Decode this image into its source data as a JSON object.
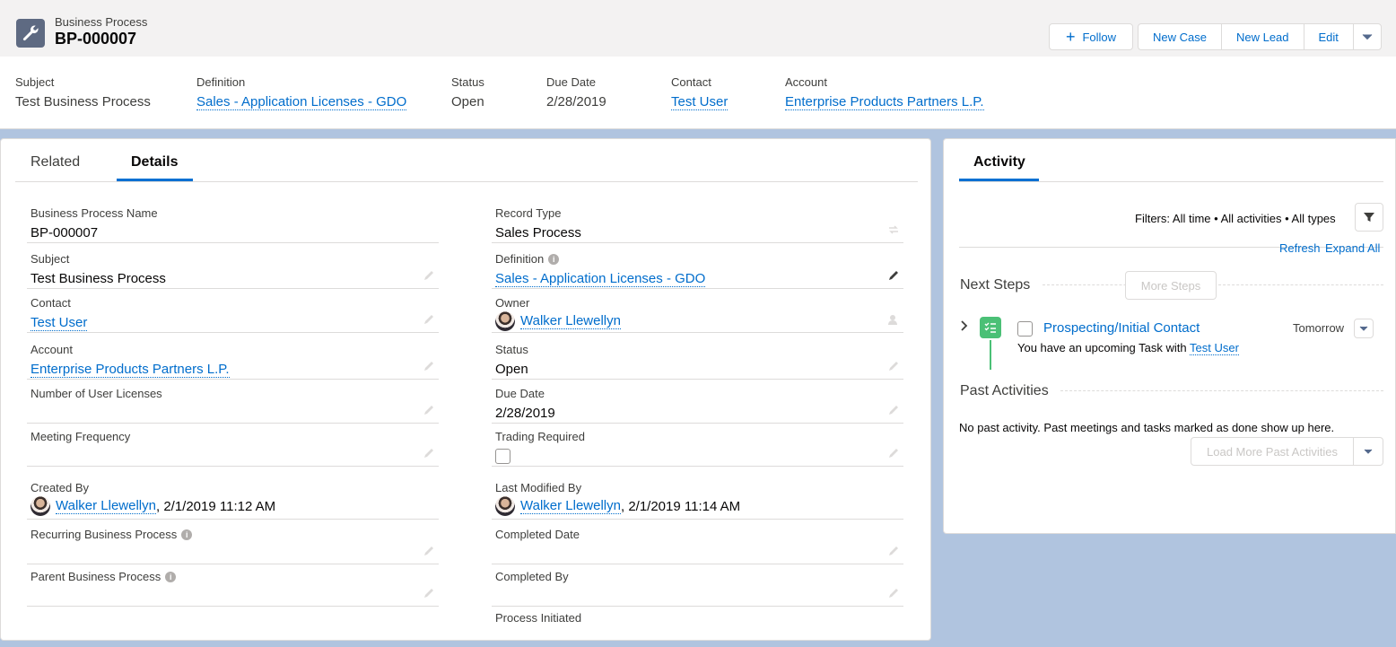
{
  "header": {
    "object_type": "Business Process",
    "record_name": "BP-000007",
    "actions": {
      "follow": "Follow",
      "new_case": "New Case",
      "new_lead": "New Lead",
      "edit": "Edit"
    },
    "highlights": [
      {
        "label": "Subject",
        "value": "Test Business Process"
      },
      {
        "label": "Definition",
        "value": "Sales - Application Licenses - GDO"
      },
      {
        "label": "Status",
        "value": "Open"
      },
      {
        "label": "Due Date",
        "value": "2/28/2019"
      },
      {
        "label": "Contact",
        "value": "Test User"
      },
      {
        "label": "Account",
        "value": "Enterprise Products Partners L.P."
      }
    ]
  },
  "tabs": {
    "related": "Related",
    "details": "Details"
  },
  "details": {
    "left": [
      {
        "label": "Business Process Name",
        "value": "BP-000007"
      },
      {
        "label": "Subject",
        "value": "Test Business Process"
      },
      {
        "label": "Contact",
        "value": "Test User"
      },
      {
        "label": "Account",
        "value": "Enterprise Products Partners L.P."
      },
      {
        "label": "Number of User Licenses",
        "value": ""
      },
      {
        "label": "Meeting Frequency",
        "value": ""
      },
      {
        "label": "Created By",
        "value": "Walker Llewellyn",
        "suffix": ", 2/1/2019 11:12 AM"
      },
      {
        "label": "Recurring Business Process",
        "value": ""
      },
      {
        "label": "Parent Business Process",
        "value": ""
      }
    ],
    "right": [
      {
        "label": "Record Type",
        "value": "Sales Process"
      },
      {
        "label": "Definition",
        "value": "Sales - Application Licenses - GDO"
      },
      {
        "label": "Owner",
        "value": "Walker Llewellyn"
      },
      {
        "label": "Status",
        "value": "Open"
      },
      {
        "label": "Due Date",
        "value": "2/28/2019"
      },
      {
        "label": "Trading Required",
        "value": ""
      },
      {
        "label": "Last Modified By",
        "value": "Walker Llewellyn",
        "suffix": ", 2/1/2019 11:14 AM"
      },
      {
        "label": "Completed Date",
        "value": ""
      },
      {
        "label": "Completed By",
        "value": ""
      },
      {
        "label": "Process Initiated",
        "value": ""
      }
    ]
  },
  "activity": {
    "tab": "Activity",
    "filters": "Filters: All time • All activities • All types",
    "refresh": "Refresh",
    "expand_all": "Expand All",
    "next_steps": "Next Steps",
    "more_steps": "More Steps",
    "task": {
      "title": "Prospecting/Initial Contact",
      "date": "Tomorrow",
      "desc_prefix": "You have an upcoming Task with ",
      "desc_link": "Test User"
    },
    "past_activities": "Past Activities",
    "no_past": "No past activity. Past meetings and tasks marked as done show up here.",
    "load_more": "Load More Past Activities"
  },
  "colors": {
    "brand_blue": "#0070d2",
    "link": "#006dcc",
    "task_green": "#4bc076",
    "icon_slate": "#5e6a82"
  }
}
